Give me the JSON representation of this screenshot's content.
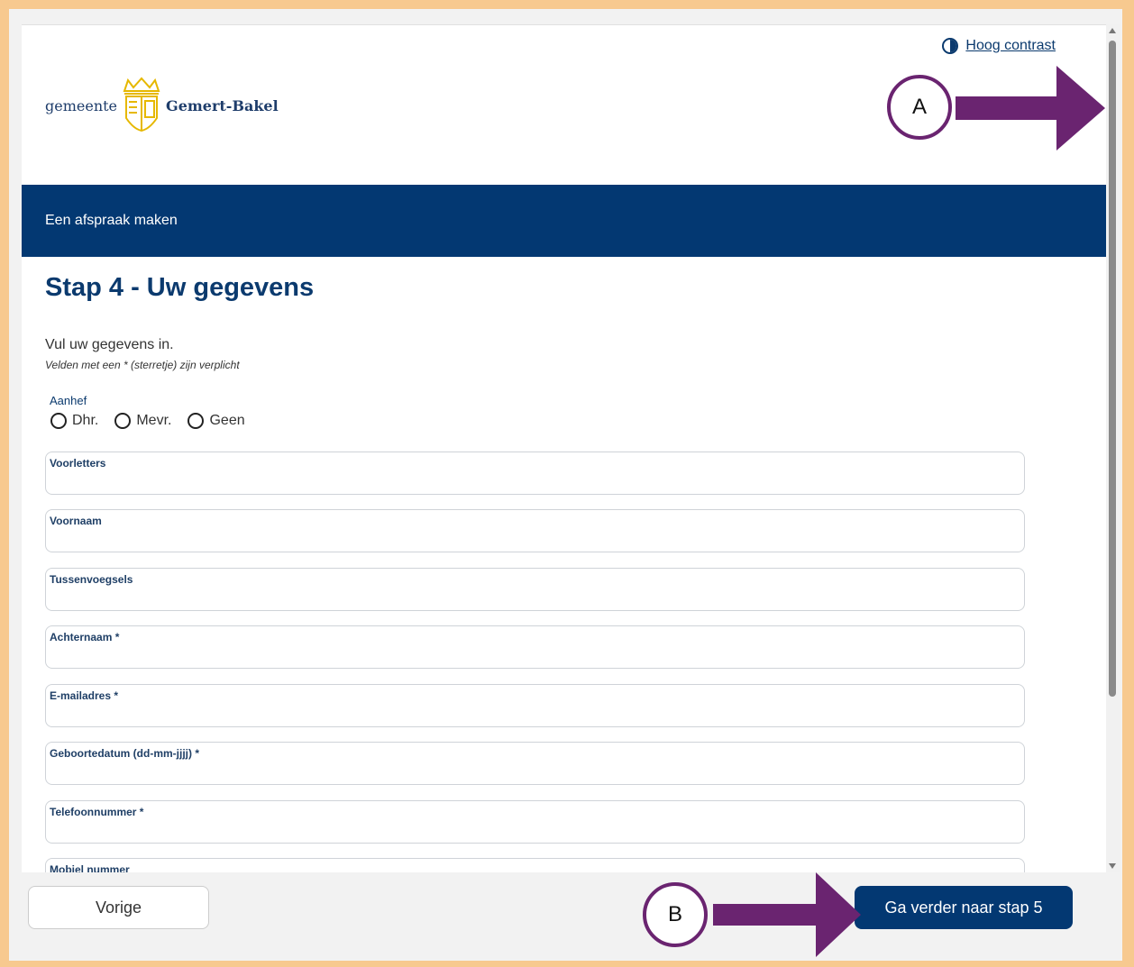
{
  "header": {
    "contrast_link": "Hoog contrast",
    "logo_prefix": "gemeente",
    "logo_name": "Gemert-Bakel"
  },
  "banner": {
    "title": "Een afspraak maken"
  },
  "page": {
    "title": "Stap 4 - Uw gegevens",
    "intro": "Vul uw gegevens in.",
    "required_note": "Velden met een * (sterretje) zijn verplicht"
  },
  "salutation": {
    "label": "Aanhef",
    "options": [
      "Dhr.",
      "Mevr.",
      "Geen"
    ]
  },
  "fields": [
    {
      "label": "Voorletters",
      "value": ""
    },
    {
      "label": "Voornaam",
      "value": ""
    },
    {
      "label": "Tussenvoegsels",
      "value": ""
    },
    {
      "label": "Achternaam *",
      "value": ""
    },
    {
      "label": "E-mailadres *",
      "value": ""
    },
    {
      "label": "Geboortedatum (dd-mm-jjjj) *",
      "value": ""
    },
    {
      "label": "Telefoonnummer *",
      "value": ""
    },
    {
      "label": "Mobiel nummer",
      "value": ""
    }
  ],
  "footer": {
    "prev_label": "Vorige",
    "next_label": "Ga verder naar stap 5"
  },
  "callouts": {
    "a": "A",
    "b": "B"
  },
  "colors": {
    "primary": "#033872",
    "callout": "#6a2470",
    "frame": "#f7c98f"
  }
}
